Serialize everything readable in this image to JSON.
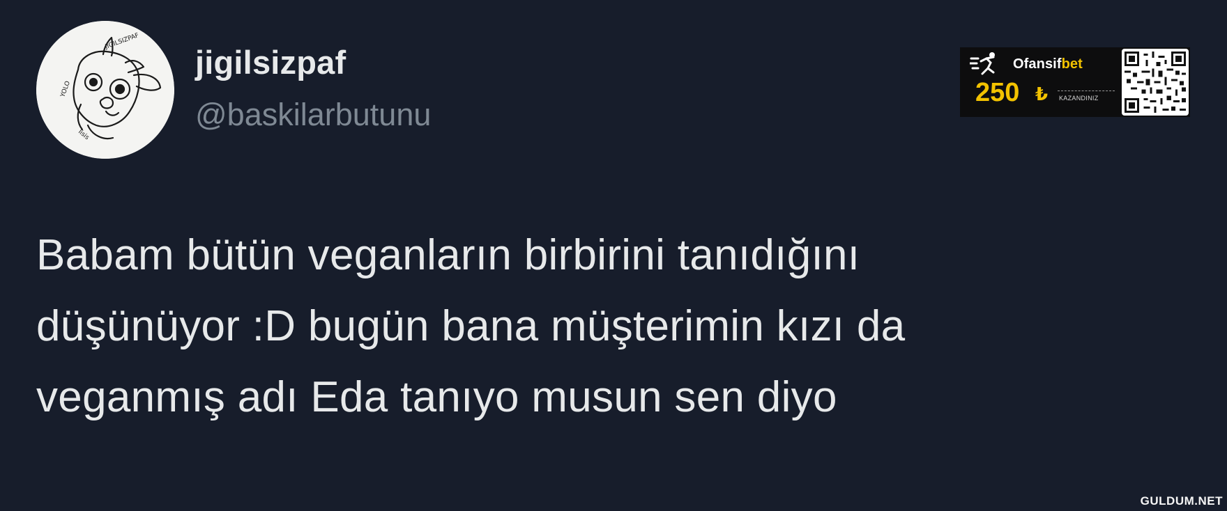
{
  "author": {
    "display_name": "jigilsizpaf",
    "handle": "@baskilarbutunu"
  },
  "ad": {
    "brand_main": "Ofansif",
    "brand_accent": "bet",
    "amount": "250",
    "currency": "₺",
    "claim": "KAZANDINIZ",
    "accent_color": "#f2c200"
  },
  "tweet": {
    "lines": [
      "Babam bütün veganların birbirini tanıdığını",
      "düşünüyor :D bugün bana müşterimin kızı da",
      "veganmış adı Eda tanıyo musun sen diyo"
    ]
  },
  "watermark": "GULDUM.NET",
  "colors": {
    "background": "#171d2b",
    "text": "#e7e9ea",
    "handle": "#7f8994"
  },
  "icons": {
    "avatar": "avatar-image",
    "runner": "runner-icon",
    "qr": "qr-code-icon"
  }
}
